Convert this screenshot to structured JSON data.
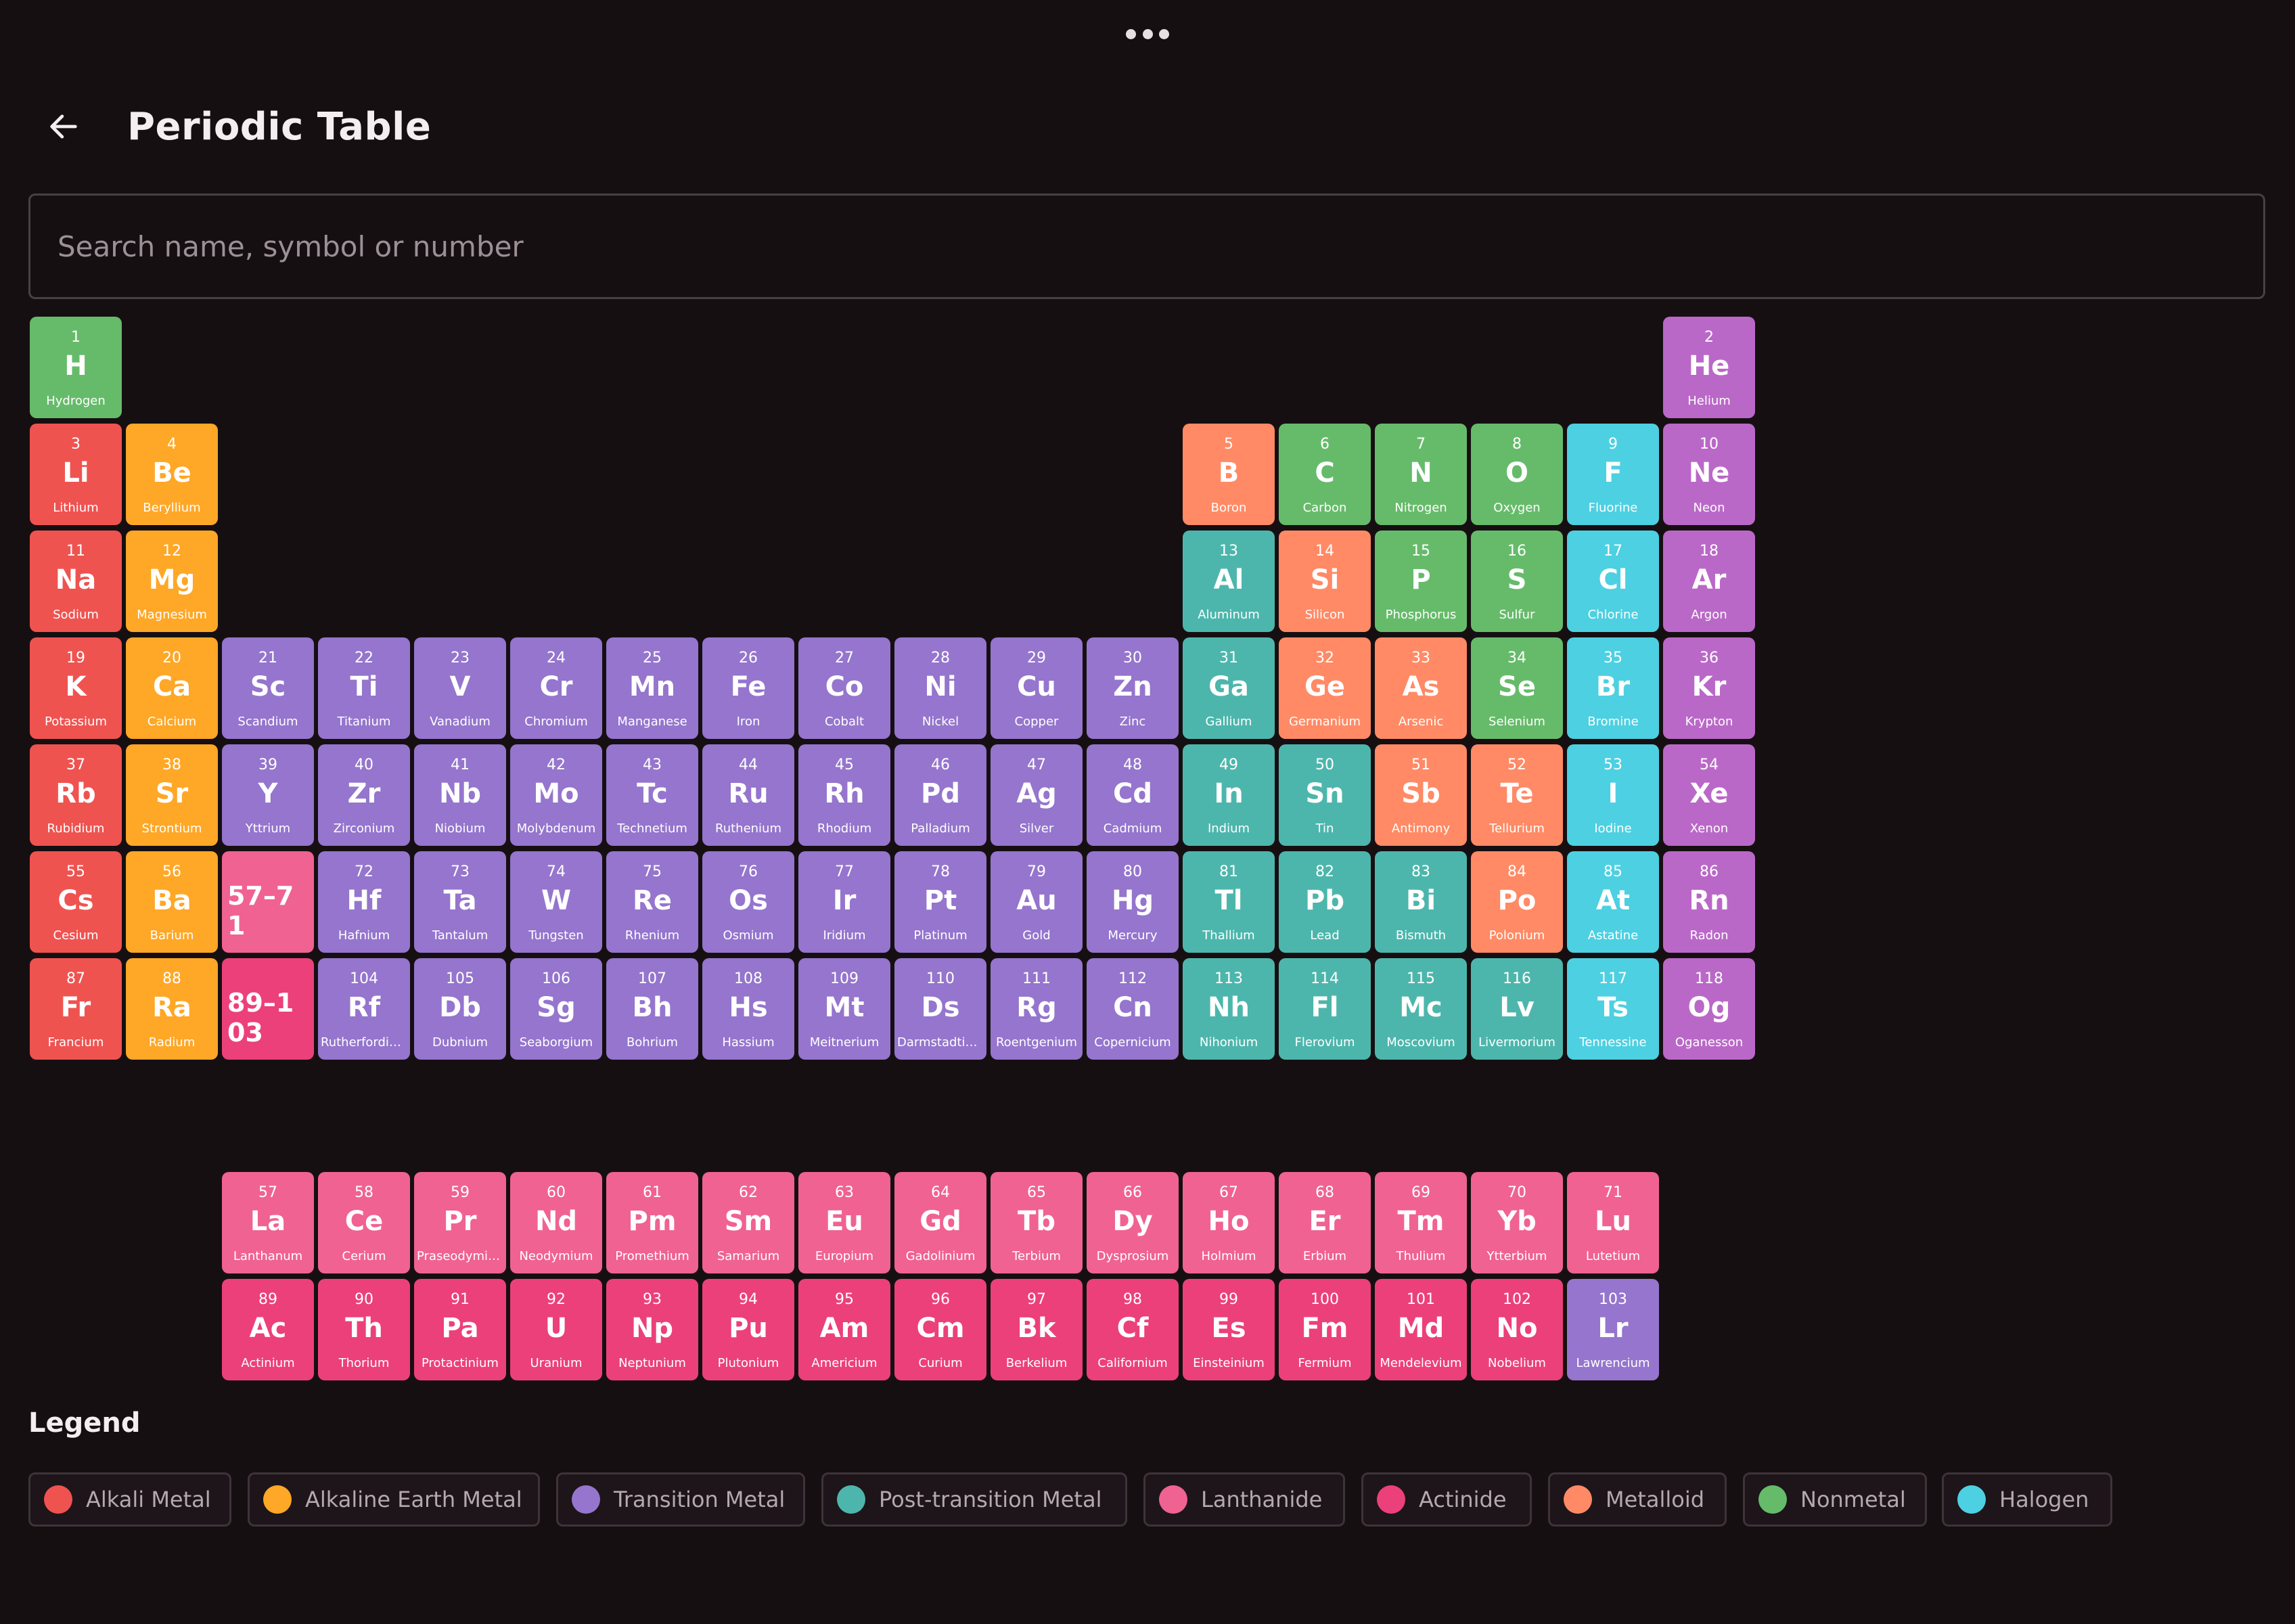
{
  "header": {
    "title": "Periodic Table"
  },
  "search": {
    "placeholder": "Search name, symbol or number",
    "value": ""
  },
  "categories": {
    "alkali": {
      "label": "Alkali Metal",
      "color": "#ef5350"
    },
    "alkaline": {
      "label": "Alkaline Earth Metal",
      "color": "#ffa726"
    },
    "transition": {
      "label": "Transition Metal",
      "color": "#9575cd"
    },
    "post": {
      "label": "Post-transition Metal",
      "color": "#4db6ac"
    },
    "lanthanide": {
      "label": "Lanthanide",
      "color": "#f06292"
    },
    "actinide": {
      "label": "Actinide",
      "color": "#ec407a"
    },
    "metalloid": {
      "label": "Metalloid",
      "color": "#ff8a65"
    },
    "nonmetal": {
      "label": "Nonmetal",
      "color": "#66bb6a"
    },
    "halogen": {
      "label": "Halogen",
      "color": "#4dd0e1"
    },
    "noble": {
      "label": "",
      "color": "#ba68c8"
    }
  },
  "elements": [
    [
      "1",
      "H",
      "Hydrogen",
      "nonmetal",
      1,
      1
    ],
    [
      "2",
      "He",
      "Helium",
      "noble",
      1,
      18
    ],
    [
      "3",
      "Li",
      "Lithium",
      "alkali",
      2,
      1
    ],
    [
      "4",
      "Be",
      "Beryllium",
      "alkaline",
      2,
      2
    ],
    [
      "5",
      "B",
      "Boron",
      "metalloid",
      2,
      13
    ],
    [
      "6",
      "C",
      "Carbon",
      "nonmetal",
      2,
      14
    ],
    [
      "7",
      "N",
      "Nitrogen",
      "nonmetal",
      2,
      15
    ],
    [
      "8",
      "O",
      "Oxygen",
      "nonmetal",
      2,
      16
    ],
    [
      "9",
      "F",
      "Fluorine",
      "halogen",
      2,
      17
    ],
    [
      "10",
      "Ne",
      "Neon",
      "noble",
      2,
      18
    ],
    [
      "11",
      "Na",
      "Sodium",
      "alkali",
      3,
      1
    ],
    [
      "12",
      "Mg",
      "Magnesium",
      "alkaline",
      3,
      2
    ],
    [
      "13",
      "Al",
      "Aluminum",
      "post",
      3,
      13
    ],
    [
      "14",
      "Si",
      "Silicon",
      "metalloid",
      3,
      14
    ],
    [
      "15",
      "P",
      "Phosphorus",
      "nonmetal",
      3,
      15
    ],
    [
      "16",
      "S",
      "Sulfur",
      "nonmetal",
      3,
      16
    ],
    [
      "17",
      "Cl",
      "Chlorine",
      "halogen",
      3,
      17
    ],
    [
      "18",
      "Ar",
      "Argon",
      "noble",
      3,
      18
    ],
    [
      "19",
      "K",
      "Potassium",
      "alkali",
      4,
      1
    ],
    [
      "20",
      "Ca",
      "Calcium",
      "alkaline",
      4,
      2
    ],
    [
      "21",
      "Sc",
      "Scandium",
      "transition",
      4,
      3
    ],
    [
      "22",
      "Ti",
      "Titanium",
      "transition",
      4,
      4
    ],
    [
      "23",
      "V",
      "Vanadium",
      "transition",
      4,
      5
    ],
    [
      "24",
      "Cr",
      "Chromium",
      "transition",
      4,
      6
    ],
    [
      "25",
      "Mn",
      "Manganese",
      "transition",
      4,
      7
    ],
    [
      "26",
      "Fe",
      "Iron",
      "transition",
      4,
      8
    ],
    [
      "27",
      "Co",
      "Cobalt",
      "transition",
      4,
      9
    ],
    [
      "28",
      "Ni",
      "Nickel",
      "transition",
      4,
      10
    ],
    [
      "29",
      "Cu",
      "Copper",
      "transition",
      4,
      11
    ],
    [
      "30",
      "Zn",
      "Zinc",
      "transition",
      4,
      12
    ],
    [
      "31",
      "Ga",
      "Gallium",
      "post",
      4,
      13
    ],
    [
      "32",
      "Ge",
      "Germanium",
      "metalloid",
      4,
      14
    ],
    [
      "33",
      "As",
      "Arsenic",
      "metalloid",
      4,
      15
    ],
    [
      "34",
      "Se",
      "Selenium",
      "nonmetal",
      4,
      16
    ],
    [
      "35",
      "Br",
      "Bromine",
      "halogen",
      4,
      17
    ],
    [
      "36",
      "Kr",
      "Krypton",
      "noble",
      4,
      18
    ],
    [
      "37",
      "Rb",
      "Rubidium",
      "alkali",
      5,
      1
    ],
    [
      "38",
      "Sr",
      "Strontium",
      "alkaline",
      5,
      2
    ],
    [
      "39",
      "Y",
      "Yttrium",
      "transition",
      5,
      3
    ],
    [
      "40",
      "Zr",
      "Zirconium",
      "transition",
      5,
      4
    ],
    [
      "41",
      "Nb",
      "Niobium",
      "transition",
      5,
      5
    ],
    [
      "42",
      "Mo",
      "Molybdenum",
      "transition",
      5,
      6
    ],
    [
      "43",
      "Tc",
      "Technetium",
      "transition",
      5,
      7
    ],
    [
      "44",
      "Ru",
      "Ruthenium",
      "transition",
      5,
      8
    ],
    [
      "45",
      "Rh",
      "Rhodium",
      "transition",
      5,
      9
    ],
    [
      "46",
      "Pd",
      "Palladium",
      "transition",
      5,
      10
    ],
    [
      "47",
      "Ag",
      "Silver",
      "transition",
      5,
      11
    ],
    [
      "48",
      "Cd",
      "Cadmium",
      "transition",
      5,
      12
    ],
    [
      "49",
      "In",
      "Indium",
      "post",
      5,
      13
    ],
    [
      "50",
      "Sn",
      "Tin",
      "post",
      5,
      14
    ],
    [
      "51",
      "Sb",
      "Antimony",
      "metalloid",
      5,
      15
    ],
    [
      "52",
      "Te",
      "Tellurium",
      "metalloid",
      5,
      16
    ],
    [
      "53",
      "I",
      "Iodine",
      "halogen",
      5,
      17
    ],
    [
      "54",
      "Xe",
      "Xenon",
      "noble",
      5,
      18
    ],
    [
      "55",
      "Cs",
      "Cesium",
      "alkali",
      6,
      1
    ],
    [
      "56",
      "Ba",
      "Barium",
      "alkaline",
      6,
      2
    ],
    [
      "72",
      "Hf",
      "Hafnium",
      "transition",
      6,
      4
    ],
    [
      "73",
      "Ta",
      "Tantalum",
      "transition",
      6,
      5
    ],
    [
      "74",
      "W",
      "Tungsten",
      "transition",
      6,
      6
    ],
    [
      "75",
      "Re",
      "Rhenium",
      "transition",
      6,
      7
    ],
    [
      "76",
      "Os",
      "Osmium",
      "transition",
      6,
      8
    ],
    [
      "77",
      "Ir",
      "Iridium",
      "transition",
      6,
      9
    ],
    [
      "78",
      "Pt",
      "Platinum",
      "transition",
      6,
      10
    ],
    [
      "79",
      "Au",
      "Gold",
      "transition",
      6,
      11
    ],
    [
      "80",
      "Hg",
      "Mercury",
      "transition",
      6,
      12
    ],
    [
      "81",
      "Tl",
      "Thallium",
      "post",
      6,
      13
    ],
    [
      "82",
      "Pb",
      "Lead",
      "post",
      6,
      14
    ],
    [
      "83",
      "Bi",
      "Bismuth",
      "post",
      6,
      15
    ],
    [
      "84",
      "Po",
      "Polonium",
      "metalloid",
      6,
      16
    ],
    [
      "85",
      "At",
      "Astatine",
      "halogen",
      6,
      17
    ],
    [
      "86",
      "Rn",
      "Radon",
      "noble",
      6,
      18
    ],
    [
      "87",
      "Fr",
      "Francium",
      "alkali",
      7,
      1
    ],
    [
      "88",
      "Ra",
      "Radium",
      "alkaline",
      7,
      2
    ],
    [
      "104",
      "Rf",
      "Rutherfordium",
      "transition",
      7,
      4
    ],
    [
      "105",
      "Db",
      "Dubnium",
      "transition",
      7,
      5
    ],
    [
      "106",
      "Sg",
      "Seaborgium",
      "transition",
      7,
      6
    ],
    [
      "107",
      "Bh",
      "Bohrium",
      "transition",
      7,
      7
    ],
    [
      "108",
      "Hs",
      "Hassium",
      "transition",
      7,
      8
    ],
    [
      "109",
      "Mt",
      "Meitnerium",
      "transition",
      7,
      9
    ],
    [
      "110",
      "Ds",
      "Darmstadtium",
      "transition",
      7,
      10
    ],
    [
      "111",
      "Rg",
      "Roentgenium",
      "transition",
      7,
      11
    ],
    [
      "112",
      "Cn",
      "Copernicium",
      "transition",
      7,
      12
    ],
    [
      "113",
      "Nh",
      "Nihonium",
      "post",
      7,
      13
    ],
    [
      "114",
      "Fl",
      "Flerovium",
      "post",
      7,
      14
    ],
    [
      "115",
      "Mc",
      "Moscovium",
      "post",
      7,
      15
    ],
    [
      "116",
      "Lv",
      "Livermorium",
      "post",
      7,
      16
    ],
    [
      "117",
      "Ts",
      "Tennessine",
      "halogen",
      7,
      17
    ],
    [
      "118",
      "Og",
      "Oganesson",
      "noble",
      7,
      18
    ],
    [
      "57",
      "La",
      "Lanthanum",
      "lanthanide",
      8,
      3
    ],
    [
      "58",
      "Ce",
      "Cerium",
      "lanthanide",
      8,
      4
    ],
    [
      "59",
      "Pr",
      "Praseodymium",
      "lanthanide",
      8,
      5
    ],
    [
      "60",
      "Nd",
      "Neodymium",
      "lanthanide",
      8,
      6
    ],
    [
      "61",
      "Pm",
      "Promethium",
      "lanthanide",
      8,
      7
    ],
    [
      "62",
      "Sm",
      "Samarium",
      "lanthanide",
      8,
      8
    ],
    [
      "63",
      "Eu",
      "Europium",
      "lanthanide",
      8,
      9
    ],
    [
      "64",
      "Gd",
      "Gadolinium",
      "lanthanide",
      8,
      10
    ],
    [
      "65",
      "Tb",
      "Terbium",
      "lanthanide",
      8,
      11
    ],
    [
      "66",
      "Dy",
      "Dysprosium",
      "lanthanide",
      8,
      12
    ],
    [
      "67",
      "Ho",
      "Holmium",
      "lanthanide",
      8,
      13
    ],
    [
      "68",
      "Er",
      "Erbium",
      "lanthanide",
      8,
      14
    ],
    [
      "69",
      "Tm",
      "Thulium",
      "lanthanide",
      8,
      15
    ],
    [
      "70",
      "Yb",
      "Ytterbium",
      "lanthanide",
      8,
      16
    ],
    [
      "71",
      "Lu",
      "Lutetium",
      "lanthanide",
      8,
      17
    ],
    [
      "89",
      "Ac",
      "Actinium",
      "actinide",
      9,
      3
    ],
    [
      "90",
      "Th",
      "Thorium",
      "actinide",
      9,
      4
    ],
    [
      "91",
      "Pa",
      "Protactinium",
      "actinide",
      9,
      5
    ],
    [
      "92",
      "U",
      "Uranium",
      "actinide",
      9,
      6
    ],
    [
      "93",
      "Np",
      "Neptunium",
      "actinide",
      9,
      7
    ],
    [
      "94",
      "Pu",
      "Plutonium",
      "actinide",
      9,
      8
    ],
    [
      "95",
      "Am",
      "Americium",
      "actinide",
      9,
      9
    ],
    [
      "96",
      "Cm",
      "Curium",
      "actinide",
      9,
      10
    ],
    [
      "97",
      "Bk",
      "Berkelium",
      "actinide",
      9,
      11
    ],
    [
      "98",
      "Cf",
      "Californium",
      "actinide",
      9,
      12
    ],
    [
      "99",
      "Es",
      "Einsteinium",
      "actinide",
      9,
      13
    ],
    [
      "100",
      "Fm",
      "Fermium",
      "actinide",
      9,
      14
    ],
    [
      "101",
      "Md",
      "Mendelevium",
      "actinide",
      9,
      15
    ],
    [
      "102",
      "No",
      "Nobelium",
      "actinide",
      9,
      16
    ],
    [
      "103",
      "Lr",
      "Lawrencium",
      "transition",
      9,
      17
    ]
  ],
  "placeholders": [
    {
      "label": "57–71",
      "category": "lanthanide",
      "row": 6,
      "col": 3
    },
    {
      "label": "89–103",
      "category": "actinide",
      "row": 7,
      "col": 3
    }
  ],
  "legend": {
    "title": "Legend",
    "items": [
      "alkali",
      "alkaline",
      "transition",
      "post",
      "lanthanide",
      "actinide",
      "metalloid",
      "nonmetal",
      "halogen"
    ]
  }
}
